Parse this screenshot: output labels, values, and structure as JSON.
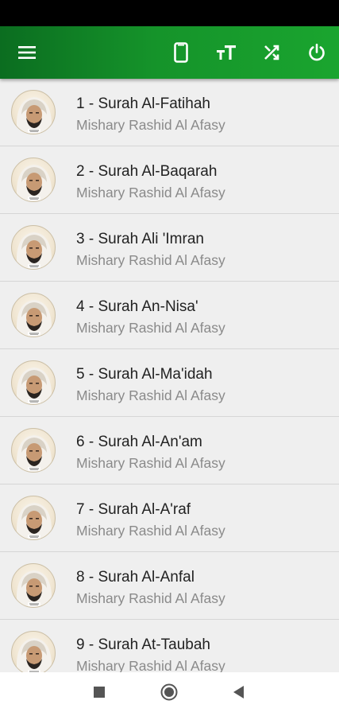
{
  "colors": {
    "app_bar_dark": "#0b6d20",
    "app_bar_light": "#1aa52f",
    "list_bg": "#efefef"
  },
  "toolbar": {
    "menu_icon": "hamburger-menu-icon",
    "actions": [
      {
        "name": "device-icon"
      },
      {
        "name": "text-size-icon"
      },
      {
        "name": "shuffle-icon"
      },
      {
        "name": "power-icon"
      }
    ]
  },
  "surahs": [
    {
      "title": "1 - Surah Al-Fatihah",
      "reciter": "Mishary Rashid Al Afasy"
    },
    {
      "title": "2 - Surah Al-Baqarah",
      "reciter": "Mishary Rashid Al Afasy"
    },
    {
      "title": "3 - Surah Ali 'Imran",
      "reciter": "Mishary Rashid Al Afasy"
    },
    {
      "title": "4 - Surah An-Nisa'",
      "reciter": "Mishary Rashid Al Afasy"
    },
    {
      "title": "5 - Surah Al-Ma'idah",
      "reciter": "Mishary Rashid Al Afasy"
    },
    {
      "title": "6 - Surah Al-An'am",
      "reciter": "Mishary Rashid Al Afasy"
    },
    {
      "title": "7 - Surah Al-A'raf",
      "reciter": "Mishary Rashid Al Afasy"
    },
    {
      "title": "8 - Surah Al-Anfal",
      "reciter": "Mishary Rashid Al Afasy"
    },
    {
      "title": "9 - Surah At-Taubah",
      "reciter": "Mishary Rashid Al Afasy"
    }
  ],
  "nav": {
    "recents_icon": "square-recents-icon",
    "home_icon": "circle-home-icon",
    "back_icon": "triangle-back-icon"
  }
}
